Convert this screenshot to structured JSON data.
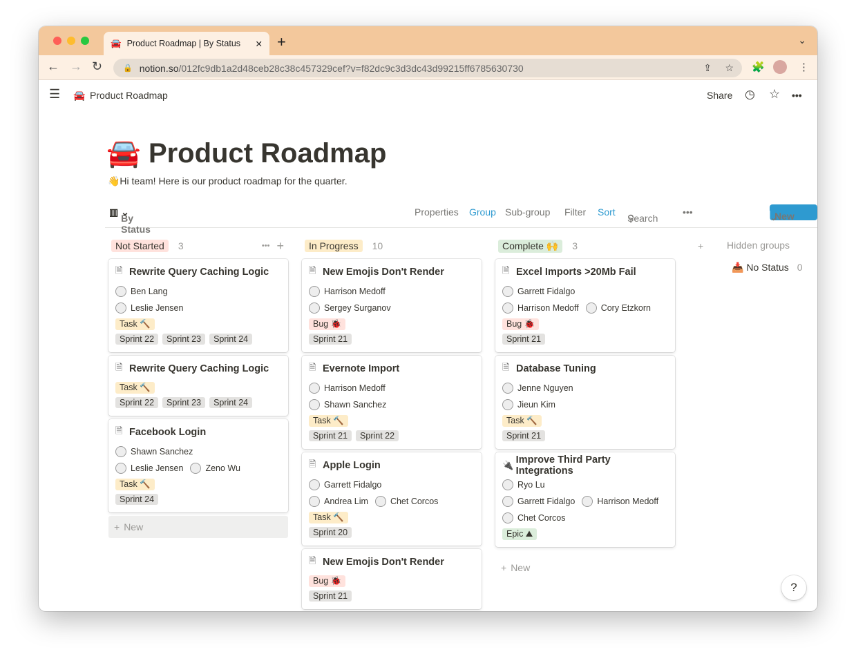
{
  "browser": {
    "tab_title": "Product Roadmap | By Status",
    "tab_icon": "🚘",
    "url_host": "notion.so",
    "url_path": "/012fc9db1a2d48ceb28c38c457329cef?v=f82dc9c3d3dc43d99215ff6785630730"
  },
  "topbar": {
    "page": "Product Roadmap",
    "icon": "🚘",
    "share": "Share"
  },
  "page": {
    "icon": "🚘",
    "title": "Product Roadmap",
    "description": "👋Hi team! Here is our product roadmap for the quarter."
  },
  "view": {
    "name": "By Status",
    "properties": "Properties",
    "group": "Group",
    "subgroup": "Sub-group",
    "filter": "Filter",
    "sort": "Sort",
    "search": "Search",
    "new": "New"
  },
  "colors": {
    "task": "#fdecc8",
    "bug": "#ffe2dd",
    "epic": "#dbeddb",
    "sprint": "#e3e2e0",
    "not_started": "#ffe2dd",
    "in_progress": "#fdecc8",
    "complete": "#dbeddb"
  },
  "columns": [
    {
      "label": "Not Started",
      "count": "3",
      "color": "#ffe2dd",
      "new_label": "New",
      "cards": [
        {
          "title": "Rewrite Query Caching Logic",
          "icon": "🗎",
          "people": [
            [
              "Ben Lang"
            ],
            [
              "Leslie Jensen"
            ]
          ],
          "type": "Task 🔨",
          "type_color": "#fdecc8",
          "sprints": [
            "Sprint 22",
            "Sprint 23",
            "Sprint 24"
          ]
        },
        {
          "title": "Rewrite Query Caching Logic",
          "icon": "🗎",
          "people": [],
          "type": "Task 🔨",
          "type_color": "#fdecc8",
          "sprints": [
            "Sprint 22",
            "Sprint 23",
            "Sprint 24"
          ]
        },
        {
          "title": "Facebook Login",
          "icon": "🗎",
          "people": [
            [
              "Shawn Sanchez"
            ],
            [
              "Leslie Jensen",
              "Zeno Wu"
            ]
          ],
          "type": "Task 🔨",
          "type_color": "#fdecc8",
          "sprints": [
            "Sprint 24"
          ]
        }
      ]
    },
    {
      "label": "In Progress",
      "count": "10",
      "color": "#fdecc8",
      "cards": [
        {
          "title": "New Emojis Don't Render",
          "icon": "🗎",
          "people": [
            [
              "Harrison Medoff"
            ],
            [
              "Sergey Surganov"
            ]
          ],
          "type": "Bug 🐞",
          "type_color": "#ffe2dd",
          "sprints": [
            "Sprint 21"
          ]
        },
        {
          "title": "Evernote Import",
          "icon": "🗎",
          "people": [
            [
              "Harrison Medoff"
            ],
            [
              "Shawn Sanchez"
            ]
          ],
          "type": "Task 🔨",
          "type_color": "#fdecc8",
          "sprints": [
            "Sprint 21",
            "Sprint 22"
          ]
        },
        {
          "title": "Apple Login",
          "icon": "🗎",
          "people": [
            [
              "Garrett Fidalgo"
            ],
            [
              "Andrea Lim",
              "Chet Corcos"
            ]
          ],
          "type": "Task 🔨",
          "type_color": "#fdecc8",
          "sprints": [
            "Sprint 20"
          ]
        },
        {
          "title": "New Emojis Don't Render",
          "icon": "🗎",
          "people": [],
          "type": "Bug 🐞",
          "type_color": "#ffe2dd",
          "sprints": [
            "Sprint 21"
          ]
        }
      ]
    },
    {
      "label": "Complete 🙌",
      "count": "3",
      "color": "#dbeddb",
      "new_label": "New",
      "cards": [
        {
          "title": "Excel Imports >20Mb Fail",
          "icon": "🗎",
          "people": [
            [
              "Garrett Fidalgo"
            ],
            [
              "Harrison Medoff",
              "Cory Etzkorn"
            ]
          ],
          "type": "Bug 🐞",
          "type_color": "#ffe2dd",
          "sprints": [
            "Sprint 21"
          ]
        },
        {
          "title": "Database Tuning",
          "icon": "🗎",
          "people": [
            [
              "Jenne Nguyen"
            ],
            [
              "Jieun Kim"
            ]
          ],
          "type": "Task 🔨",
          "type_color": "#fdecc8",
          "sprints": [
            "Sprint 21"
          ]
        },
        {
          "title": "Improve Third Party Integrations",
          "icon": "🔌",
          "people": [
            [
              "Ryo Lu"
            ],
            [
              "Garrett Fidalgo",
              "Harrison Medoff"
            ],
            [
              "Chet Corcos"
            ]
          ],
          "type": "Epic ⛰",
          "type_color": "#dbeddb",
          "sprints": []
        }
      ]
    }
  ],
  "hidden": {
    "label": "Hidden groups",
    "no_status": "No Status",
    "no_status_count": "0"
  },
  "help": "?"
}
